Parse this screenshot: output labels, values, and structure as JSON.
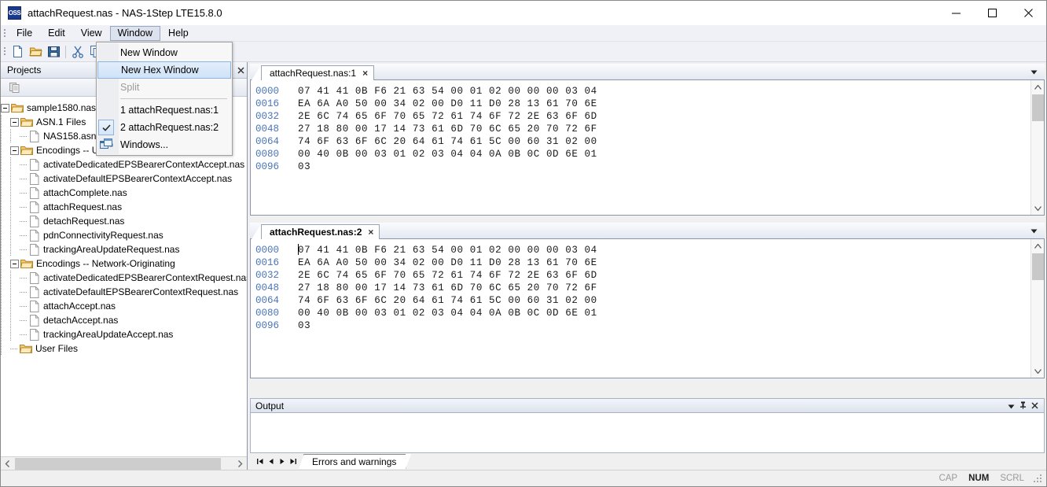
{
  "window": {
    "app_icon_text": "OSS",
    "title": "attachRequest.nas - NAS-1Step LTE15.8.0",
    "minimize": "minimize-button",
    "maximize": "maximize-button",
    "close": "close-button"
  },
  "menubar": {
    "items": [
      {
        "label": "File",
        "open": false
      },
      {
        "label": "Edit",
        "open": false
      },
      {
        "label": "View",
        "open": false
      },
      {
        "label": "Window",
        "open": true
      },
      {
        "label": "Help",
        "open": false
      }
    ]
  },
  "window_menu": {
    "items": [
      {
        "label": "New Window",
        "state": "normal",
        "icon": ""
      },
      {
        "label": "New Hex Window",
        "state": "highlighted",
        "icon": ""
      },
      {
        "label": "Split",
        "state": "disabled",
        "icon": ""
      },
      {
        "separator": true
      },
      {
        "label": "1 attachRequest.nas:1",
        "state": "normal",
        "icon": ""
      },
      {
        "label": "2 attachRequest.nas:2",
        "state": "normal",
        "icon": "check-icon"
      },
      {
        "label": "Windows...",
        "state": "normal",
        "icon": "windows-cascade-icon"
      }
    ]
  },
  "toolbar": {
    "buttons": [
      {
        "name": "new-file-icon"
      },
      {
        "name": "open-folder-icon"
      },
      {
        "name": "save-icon"
      },
      {
        "name": "separator"
      },
      {
        "name": "cut-icon"
      },
      {
        "name": "copy-icon"
      }
    ]
  },
  "projects_panel": {
    "title": "Projects",
    "toolbar_icon": "copy-pages-icon",
    "dropdown_button": "panel-menu-icon",
    "close_button": "panel-close-icon",
    "tree": [
      {
        "level": 0,
        "type": "folder",
        "expanded": true,
        "label": "sample1580.nas"
      },
      {
        "level": 1,
        "type": "folder",
        "expanded": true,
        "label": "ASN.1 Files"
      },
      {
        "level": 2,
        "type": "file",
        "expanded": false,
        "label": "NAS158.asn"
      },
      {
        "level": 1,
        "type": "folder",
        "expanded": true,
        "label": "Encodings -- UE-Originating"
      },
      {
        "level": 2,
        "type": "file",
        "expanded": false,
        "label": "activateDedicatedEPSBearerContextAccept.nas"
      },
      {
        "level": 2,
        "type": "file",
        "expanded": false,
        "label": "activateDefaultEPSBearerContextAccept.nas"
      },
      {
        "level": 2,
        "type": "file",
        "expanded": false,
        "label": "attachComplete.nas"
      },
      {
        "level": 2,
        "type": "file",
        "expanded": false,
        "label": "attachRequest.nas"
      },
      {
        "level": 2,
        "type": "file",
        "expanded": false,
        "label": "detachRequest.nas"
      },
      {
        "level": 2,
        "type": "file",
        "expanded": false,
        "label": "pdnConnectivityRequest.nas"
      },
      {
        "level": 2,
        "type": "file",
        "expanded": false,
        "label": "trackingAreaUpdateRequest.nas"
      },
      {
        "level": 1,
        "type": "folder",
        "expanded": true,
        "label": "Encodings -- Network-Originating"
      },
      {
        "level": 2,
        "type": "file",
        "expanded": false,
        "label": "activateDedicatedEPSBearerContextRequest.nas"
      },
      {
        "level": 2,
        "type": "file",
        "expanded": false,
        "label": "activateDefaultEPSBearerContextRequest.nas"
      },
      {
        "level": 2,
        "type": "file",
        "expanded": false,
        "label": "attachAccept.nas"
      },
      {
        "level": 2,
        "type": "file",
        "expanded": false,
        "label": "detachAccept.nas"
      },
      {
        "level": 2,
        "type": "file",
        "expanded": false,
        "label": "trackingAreaUpdateAccept.nas"
      },
      {
        "level": 1,
        "type": "folder",
        "expanded": false,
        "label": "User Files"
      }
    ],
    "hscroll": {
      "left_arrow": "‹",
      "right_arrow": "›"
    }
  },
  "hex_windows": [
    {
      "tab_label": "attachRequest.nas:1",
      "tab_close": "×",
      "active": false,
      "cursor_visible": false,
      "rows": [
        {
          "offset": "0000",
          "bytes": "07 41 41 0B F6 21 63 54 00 01 02 00 00 00 03 04"
        },
        {
          "offset": "0016",
          "bytes": "EA 6A A0 50 00 34 02 00 D0 11 D0 28 13 61 70 6E"
        },
        {
          "offset": "0032",
          "bytes": "2E 6C 74 65 6F 70 65 72 61 74 6F 72 2E 63 6F 6D"
        },
        {
          "offset": "0048",
          "bytes": "27 18 80 00 17 14 73 61 6D 70 6C 65 20 70 72 6F"
        },
        {
          "offset": "0064",
          "bytes": "74 6F 63 6F 6C 20 64 61 74 61 5C 00 60 31 02 00"
        },
        {
          "offset": "0080",
          "bytes": "00 40 0B 00 03 01 02 03 04 04 0A 0B 0C 0D 6E 01"
        },
        {
          "offset": "0096",
          "bytes": "03"
        }
      ]
    },
    {
      "tab_label": "attachRequest.nas:2",
      "tab_close": "×",
      "active": true,
      "cursor_visible": true,
      "rows": [
        {
          "offset": "0000",
          "bytes": "07 41 41 0B F6 21 63 54 00 01 02 00 00 00 03 04"
        },
        {
          "offset": "0016",
          "bytes": "EA 6A A0 50 00 34 02 00 D0 11 D0 28 13 61 70 6E"
        },
        {
          "offset": "0032",
          "bytes": "2E 6C 74 65 6F 70 65 72 61 74 6F 72 2E 63 6F 6D"
        },
        {
          "offset": "0048",
          "bytes": "27 18 80 00 17 14 73 61 6D 70 6C 65 20 70 72 6F"
        },
        {
          "offset": "0064",
          "bytes": "74 6F 63 6F 6C 20 64 61 74 61 5C 00 60 31 02 00"
        },
        {
          "offset": "0080",
          "bytes": "00 40 0B 00 03 01 02 03 04 04 0A 0B 0C 0D 6E 01"
        },
        {
          "offset": "0096",
          "bytes": "03"
        }
      ]
    }
  ],
  "output_panel": {
    "title": "Output",
    "dropdown_icon": "▼",
    "pin_icon": "pin-icon",
    "close_icon": "×",
    "content": "",
    "nav": {
      "first": "❘◂",
      "prev": "◂",
      "next": "▸",
      "last": "▸❘"
    },
    "tabs": [
      {
        "label": "Errors and warnings",
        "active": true
      }
    ]
  },
  "statusbar": {
    "message": "",
    "indicators": [
      {
        "label": "CAP",
        "active": false
      },
      {
        "label": "NUM",
        "active": true
      },
      {
        "label": "SCRL",
        "active": false
      }
    ]
  },
  "colors": {
    "title_bar": "#ffffff",
    "menu_bar": "#eff1f7",
    "accent_blue": "#1a3a8f",
    "hex_offset": "#4a74b8",
    "panel_gradient_top": "#f5f7fb",
    "panel_gradient_bottom": "#dfe4ee",
    "menu_highlight": "#cfe2f8"
  }
}
